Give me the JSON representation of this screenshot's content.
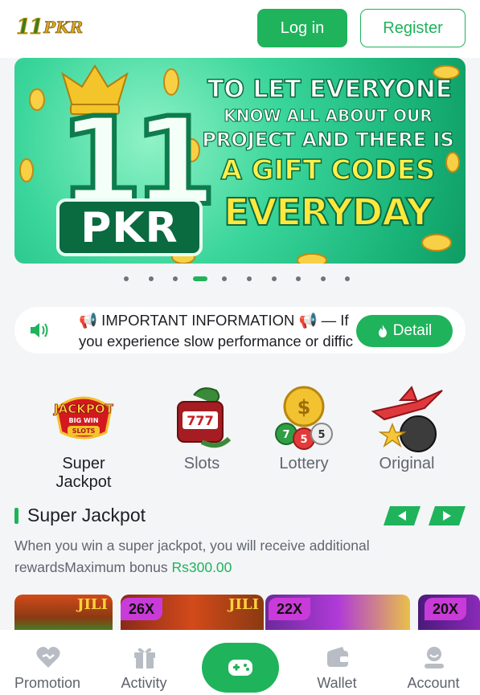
{
  "header": {
    "logo_num": "11",
    "logo_text": "PKR",
    "login_label": "Log in",
    "register_label": "Register"
  },
  "banner": {
    "badge_number": "11",
    "badge_text": "PKR",
    "line1": "TO LET EVERYONE",
    "line2": "KNOW ALL ABOUT OUR",
    "line3": "PROJECT AND THERE IS",
    "line4": "A GIFT CODES",
    "line5": "EVERYDAY",
    "slide_count": 10,
    "active_slide": 4
  },
  "notice": {
    "text": "📢 IMPORTANT INFORMATION 📢 — If you experience slow performance or diffic",
    "detail_label": "Detail"
  },
  "categories": [
    {
      "label": "Super Jackpot",
      "icon": "jackpot-icon",
      "logo_top": "JACKPOT",
      "logo_mid": "BIG WIN",
      "logo_bottom": "SLOTS"
    },
    {
      "label": "Slots",
      "icon": "slots-icon",
      "reel": "777"
    },
    {
      "label": "Lottery",
      "icon": "lottery-icon",
      "balls": [
        "7",
        "5",
        "5"
      ]
    },
    {
      "label": "Original",
      "icon": "original-icon"
    }
  ],
  "section": {
    "title": "Super Jackpot",
    "desc": "When you win a super jackpot, you will receive additional rewardsMaximum bonus ",
    "amount": "Rs300.00"
  },
  "tiles": [
    {
      "badge": "",
      "brand": "JILI"
    },
    {
      "badge": "26X",
      "brand": "JILI"
    },
    {
      "badge": "22X",
      "brand": ""
    },
    {
      "badge": "20X",
      "brand": ""
    }
  ],
  "nav": {
    "items": [
      "Promotion",
      "Activity",
      "",
      "Wallet",
      "Account"
    ]
  },
  "colors": {
    "accent": "#1fb35b",
    "text": "#1d1f24",
    "muted": "#60656f"
  }
}
